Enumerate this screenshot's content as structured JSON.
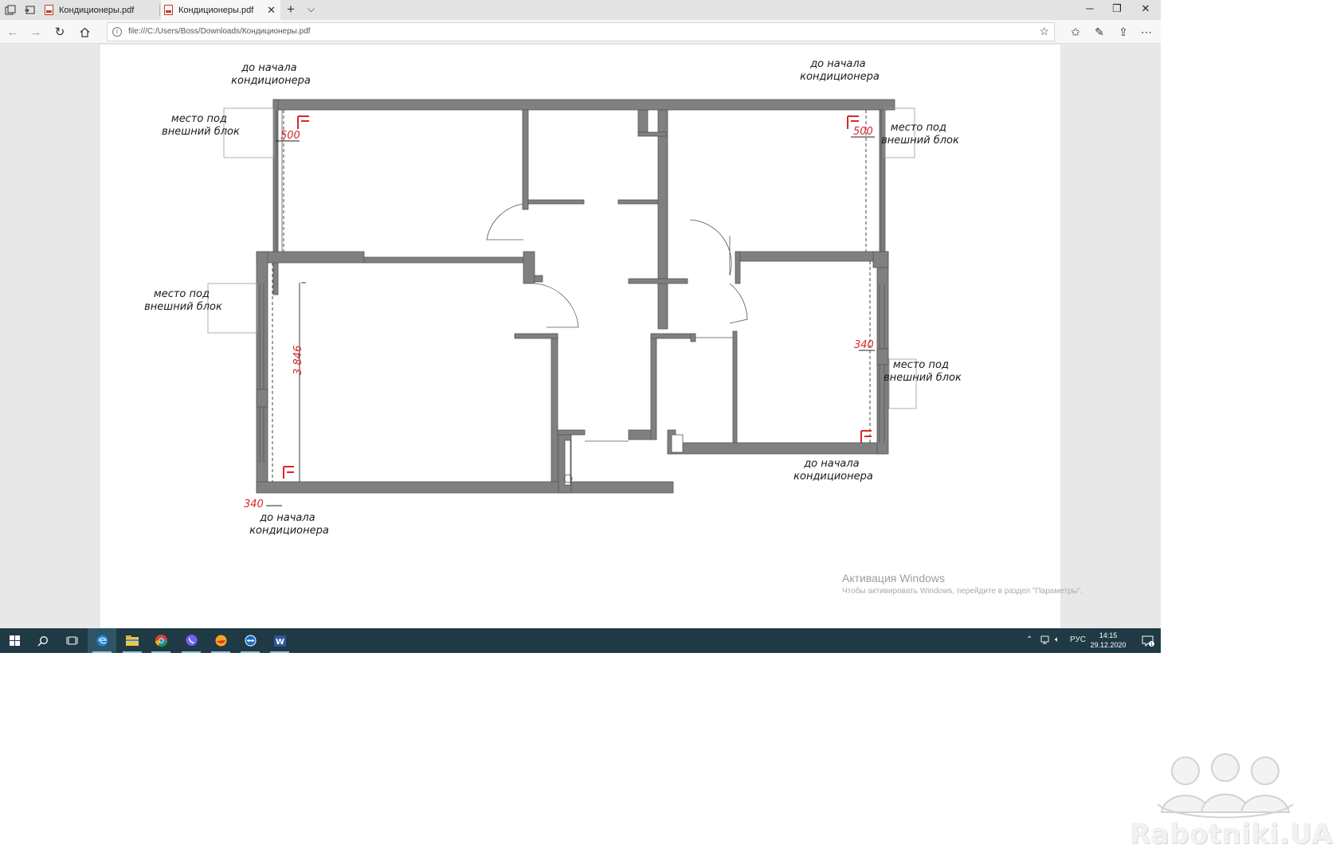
{
  "browser": {
    "tabs": [
      {
        "title": "Кондиционеры.pdf",
        "active": false
      },
      {
        "title": "Кондиционеры.pdf",
        "active": true
      }
    ],
    "address": "file:///C:/Users/Boss/Downloads/Кондиционеры.pdf"
  },
  "floor_plan": {
    "labels": {
      "start_top_left": [
        "до начала",
        "кондиционера"
      ],
      "start_top_right": [
        "до начала",
        "кондиционера"
      ],
      "start_bottom_right": [
        "до начала",
        "кондиционера"
      ],
      "start_bottom_left": [
        "до начала",
        "кондиционера"
      ],
      "unit_top_left": [
        "место под",
        "внешний блок"
      ],
      "unit_top_right": [
        "место под",
        "внешний блок"
      ],
      "unit_mid_left": [
        "место под",
        "внешний блок"
      ],
      "unit_mid_right": [
        "место под",
        "внешний блок"
      ]
    },
    "dimensions": {
      "top_left": "500",
      "top_right": "500",
      "left_vertical": "3 846",
      "bottom_left": "340",
      "right_middle": "340"
    }
  },
  "activation": {
    "title": "Активация Windows",
    "subtitle": "Чтобы активировать Windows, перейдите в раздел \"Параметры\"."
  },
  "taskbar": {
    "apps": [
      "edge-icon",
      "file-explorer-icon",
      "chrome-icon",
      "viber-icon",
      "browser-icon",
      "teamviewer-icon",
      "word-icon"
    ],
    "tray": {
      "language": "РУС",
      "time": "14:15",
      "date": "29.12.2020",
      "notification_count": "1"
    }
  },
  "watermark": {
    "text": "Rabotniki.UA"
  }
}
